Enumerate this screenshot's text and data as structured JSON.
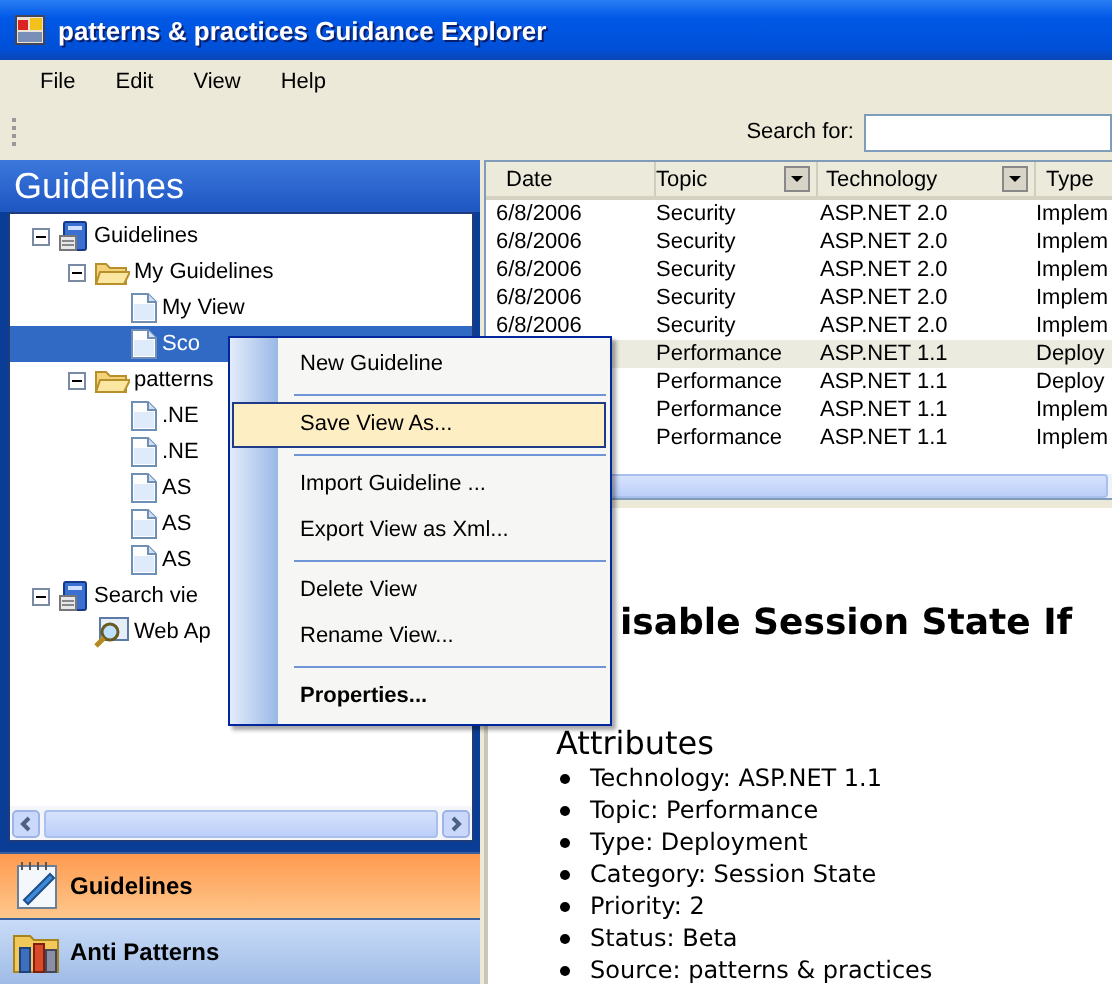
{
  "window": {
    "title": "patterns & practices Guidance Explorer"
  },
  "menu_bar": [
    "File",
    "Edit",
    "View",
    "Help"
  ],
  "toolbar": {
    "search_label": "Search for:"
  },
  "left_panel": {
    "title": "Guidelines",
    "tree": [
      {
        "label": "Guidelines",
        "kind": "database",
        "selected": false,
        "expanded": true,
        "children": [
          {
            "label": "My Guidelines",
            "kind": "folder",
            "selected": false,
            "expanded": true,
            "children": [
              {
                "label": "My View",
                "kind": "document",
                "selected": false
              },
              {
                "label": "Sco",
                "kind": "document",
                "selected": true
              }
            ]
          },
          {
            "label": "patterns",
            "kind": "folder",
            "selected": false,
            "expanded": true,
            "children": [
              {
                "label": ".NE",
                "kind": "document",
                "selected": false
              },
              {
                "label": ".NE",
                "kind": "document",
                "selected": false
              },
              {
                "label": "AS",
                "kind": "document",
                "selected": false
              },
              {
                "label": "AS",
                "kind": "document",
                "selected": false
              },
              {
                "label": "AS",
                "kind": "document",
                "selected": false
              }
            ]
          }
        ]
      },
      {
        "label": "Search vie",
        "kind": "database",
        "selected": false,
        "expanded": true,
        "children": [
          {
            "label": "Web Ap",
            "kind": "search",
            "selected": false
          }
        ]
      }
    ],
    "nav_buttons": [
      {
        "label": "Guidelines",
        "kind": "notepad",
        "selected": true
      },
      {
        "label": "Anti Patterns",
        "kind": "toolbox",
        "selected": false
      }
    ]
  },
  "table": {
    "columns": [
      {
        "label": "Date",
        "filter": false
      },
      {
        "label": "Topic",
        "filter": true
      },
      {
        "label": "Technology",
        "filter": true
      },
      {
        "label": "Type"
      }
    ],
    "rows": [
      {
        "cells": [
          "6/8/2006",
          "Security",
          "ASP.NET 2.0",
          "Implem"
        ],
        "selected": false
      },
      {
        "cells": [
          "6/8/2006",
          "Security",
          "ASP.NET 2.0",
          "Implem"
        ],
        "selected": false
      },
      {
        "cells": [
          "6/8/2006",
          "Security",
          "ASP.NET 2.0",
          "Implem"
        ],
        "selected": false
      },
      {
        "cells": [
          "6/8/2006",
          "Security",
          "ASP.NET 2.0",
          "Implem"
        ],
        "selected": false
      },
      {
        "cells": [
          "6/8/2006",
          "Security",
          "ASP.NET 2.0",
          "Implem"
        ],
        "selected": false
      },
      {
        "cells": [
          "",
          "Performance",
          "ASP.NET 1.1",
          "Deploy"
        ],
        "selected": true
      },
      {
        "cells": [
          "",
          "Performance",
          "ASP.NET 1.1",
          "Deploy"
        ],
        "selected": false
      },
      {
        "cells": [
          "",
          "Performance",
          "ASP.NET 1.1",
          "Implem"
        ],
        "selected": false
      },
      {
        "cells": [
          "",
          "Performance",
          "ASP.NET 1.1",
          "Implem"
        ],
        "selected": false
      }
    ]
  },
  "document": {
    "title": "isable Session State If",
    "section": "Attributes",
    "attributes": [
      "Technology: ASP.NET 1.1",
      "Topic: Performance",
      "Type: Deployment",
      "Category: Session State",
      "Priority: 2",
      "Status: Beta",
      "Source: patterns & practices"
    ]
  },
  "context_menu": {
    "groups": [
      [
        {
          "label": "New Guideline",
          "selected": false,
          "default": false
        }
      ],
      [
        {
          "label": "Save View As...",
          "selected": true,
          "default": false
        }
      ],
      [
        {
          "label": "Import Guideline ...",
          "selected": false,
          "default": false
        },
        {
          "label": "Export View as Xml...",
          "selected": false,
          "default": false
        }
      ],
      [
        {
          "label": "Delete View",
          "selected": false,
          "default": false
        },
        {
          "label": "Rename View...",
          "selected": false,
          "default": false
        }
      ],
      [
        {
          "label": "Properties...",
          "selected": false,
          "default": true
        }
      ]
    ]
  }
}
